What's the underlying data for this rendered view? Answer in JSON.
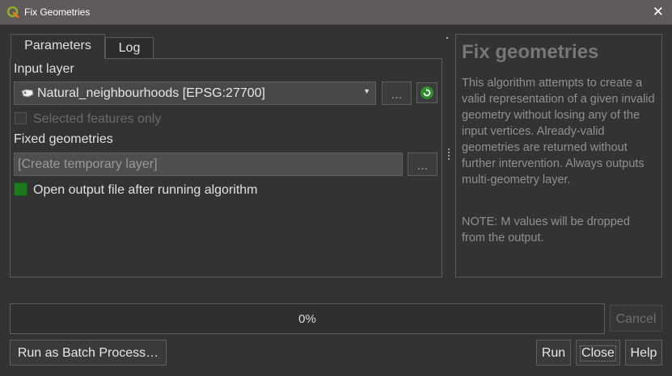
{
  "window": {
    "title": "Fix Geometries",
    "app_icon": "qgis-icon",
    "close_icon": "close-icon",
    "close_glyph": "✕"
  },
  "tabs": [
    {
      "label": "Parameters",
      "active": true
    },
    {
      "label": "Log",
      "active": false
    }
  ],
  "parameters": {
    "input_layer_label": "Input layer",
    "input_layer_value": "Natural_neighbourhoods [EPSG:27700]",
    "input_layer_icon": "polygon-layer-icon",
    "browse_label": "…",
    "refresh_icon": "refresh-icon",
    "selected_only_label": "Selected features only",
    "selected_only_checked": false,
    "selected_only_enabled": false,
    "fixed_geometries_label": "Fixed geometries",
    "fixed_geometries_placeholder": "[Create temporary layer]",
    "output_browse_label": "…",
    "open_output_label": "Open output file after running algorithm",
    "open_output_checked": true
  },
  "help": {
    "title": "Fix geometries",
    "body": "This algorithm attempts to create a valid representation of a given invalid geometry without losing any of the input vertices. Already-valid geometries are returned without further intervention. Always outputs multi-geometry layer.",
    "note": "NOTE: M values will be dropped from the output."
  },
  "progress": {
    "text": "0%",
    "value": 0
  },
  "buttons": {
    "cancel": "Cancel",
    "batch": "Run as Batch Process…",
    "run": "Run",
    "close": "Close",
    "help": "Help"
  },
  "colors": {
    "accent_green": "#1c7a1c",
    "titlebar": "#5f5b5b",
    "background": "#333333"
  }
}
